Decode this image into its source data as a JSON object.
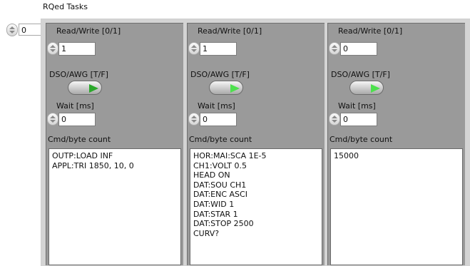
{
  "array_label": "RQed Tasks",
  "index_value": "0",
  "clusters": [
    {
      "rw_label": "Read/Write [0/1]",
      "rw_value": "1",
      "dso_label": "DSO/AWG [T/F]",
      "dso_state": false,
      "wait_label": "Wait [ms]",
      "wait_value": "0",
      "cmd_label": "Cmd/byte count",
      "cmd_lines": [
        "OUTP:LOAD INF",
        "APPL:TRI 1850, 10, 0"
      ]
    },
    {
      "rw_label": "Read/Write [0/1]",
      "rw_value": "1",
      "dso_label": "DSO/AWG [T/F]",
      "dso_state": true,
      "wait_label": "Wait [ms]",
      "wait_value": "0",
      "cmd_label": "Cmd/byte count",
      "cmd_lines": [
        "HOR:MAI:SCA 1E-5",
        "CH1:VOLT 0.5",
        "HEAD ON",
        "DAT:SOU CH1",
        "DAT:ENC ASCI",
        "DAT:WID 1",
        "DAT:STAR 1",
        "DAT:STOP 2500",
        "CURV?"
      ]
    },
    {
      "rw_label": "Read/Write [0/1]",
      "rw_value": "0",
      "dso_label": "DSO/AWG [T/F]",
      "dso_state": true,
      "wait_label": "Wait [ms]",
      "wait_value": "0",
      "cmd_label": "Cmd/byte count",
      "cmd_lines": [
        "15000"
      ]
    }
  ]
}
